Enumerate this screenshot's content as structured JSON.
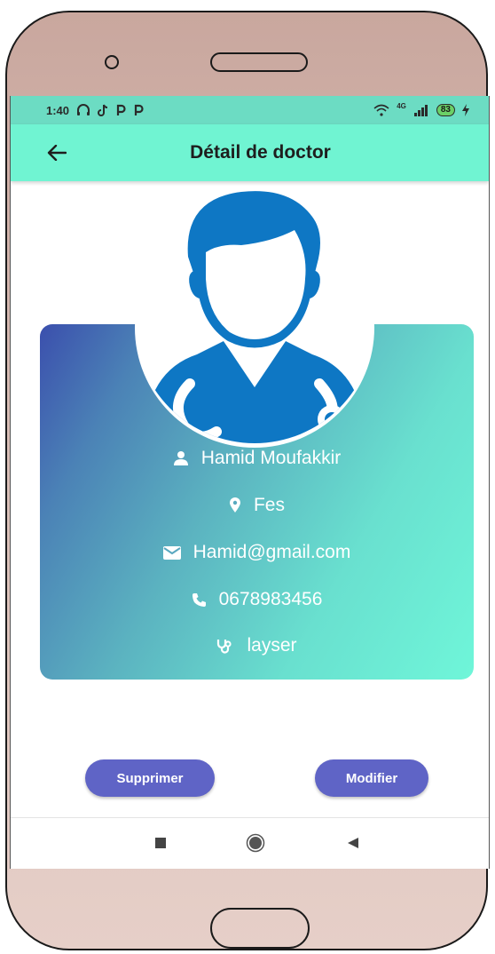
{
  "status_bar": {
    "time": "1:40",
    "network": "4G",
    "battery": "83"
  },
  "app_bar": {
    "title": "Détail de doctor"
  },
  "doctor": {
    "name": "Hamid Moufakkir",
    "city": "Fes",
    "email": "Hamid@gmail.com",
    "phone": "0678983456",
    "specialty": "layser"
  },
  "actions": {
    "delete_label": "Supprimer",
    "edit_label": "Modifier"
  },
  "colors": {
    "app_bar": "#70f4d2",
    "status_bar": "#6cdcc3",
    "button": "#5f64c6",
    "avatar_blue": "#0e77c4",
    "card_gradient_start": "#3b4fad",
    "card_gradient_end": "#6ff6d9"
  },
  "icons": {
    "back": "arrow-left-icon",
    "name": "person-icon",
    "city": "location-pin-icon",
    "email": "mail-icon",
    "phone": "phone-icon",
    "specialty": "stethoscope-icon"
  }
}
